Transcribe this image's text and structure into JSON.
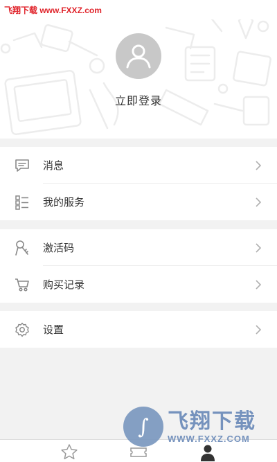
{
  "watermark_top": "飞翔下载 www.FXXZ.com",
  "profile": {
    "login_label": "立即登录",
    "avatar_icon": "user-avatar-icon"
  },
  "menu": {
    "group1": [
      {
        "label": "消息",
        "icon": "message-icon"
      },
      {
        "label": "我的服务",
        "icon": "service-list-icon"
      }
    ],
    "group2": [
      {
        "label": "激活码",
        "icon": "key-icon"
      },
      {
        "label": "购买记录",
        "icon": "cart-icon"
      }
    ],
    "group3": [
      {
        "label": "设置",
        "icon": "gear-icon"
      }
    ]
  },
  "watermark_bottom": {
    "title": "飞翔下载",
    "url": "WWW.FXXZ.COM"
  },
  "tabbar": {
    "tabs": [
      {
        "icon": "star-icon",
        "active": false
      },
      {
        "icon": "ticket-icon",
        "active": false
      },
      {
        "icon": "person-icon",
        "active": true
      }
    ]
  },
  "colors": {
    "background": "#f2f2f2",
    "card": "#ffffff",
    "text": "#333333",
    "icon": "#888888",
    "avatar": "#c8c8c8",
    "watermark_red": "#e0242b"
  }
}
